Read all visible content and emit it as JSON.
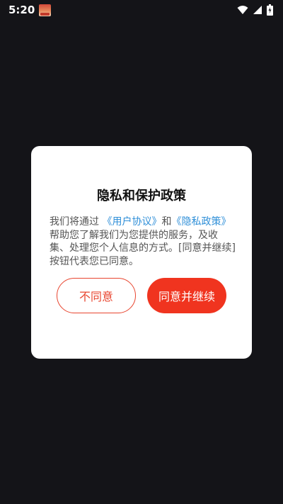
{
  "status_bar": {
    "time": "5:20",
    "icons": [
      "app-thumbnail-icon",
      "wifi-icon",
      "cellular-signal-icon",
      "battery-charging-icon"
    ]
  },
  "dialog": {
    "title": "隐私和保护政策",
    "body": {
      "prefix": "我们将通过 ",
      "user_agreement_link": "《用户协议》",
      "connector": "和",
      "privacy_policy_link": "《隐私政策》",
      "suffix": "帮助您了解我们为您提供的服务，及收集、处理您个人信息的方式。[同意并继续]按钮代表您已同意。"
    },
    "decline_label": "不同意",
    "agree_label": "同意并继续"
  },
  "colors": {
    "background": "#141418",
    "accent": "#f0341f",
    "link": "#2f8fd8"
  }
}
